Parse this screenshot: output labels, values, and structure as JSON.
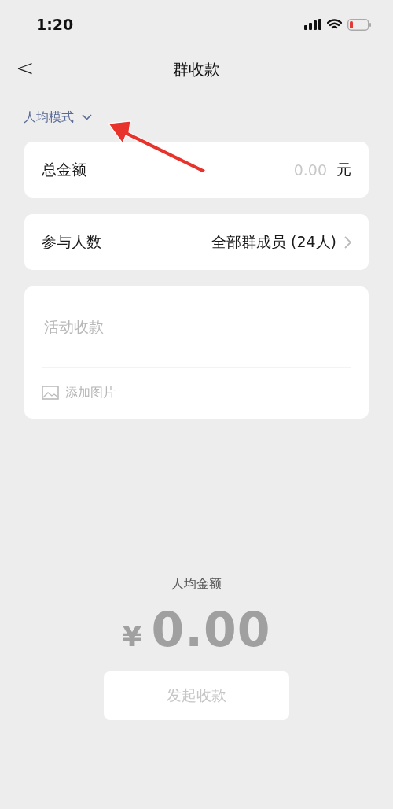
{
  "status_bar": {
    "time": "1:20"
  },
  "nav": {
    "back": "<",
    "title": "群收款"
  },
  "mode": {
    "label": "人均模式"
  },
  "total": {
    "label": "总金额",
    "placeholder": "0.00",
    "unit": "元"
  },
  "participants": {
    "label": "参与人数",
    "value": "全部群成员 (24人)"
  },
  "note": {
    "placeholder": "活动收款",
    "add_image": "添加图片"
  },
  "per_person": {
    "label": "人均金额",
    "currency": "¥",
    "amount": "0.00"
  },
  "submit": {
    "label": "发起收款",
    "disabled": true
  }
}
